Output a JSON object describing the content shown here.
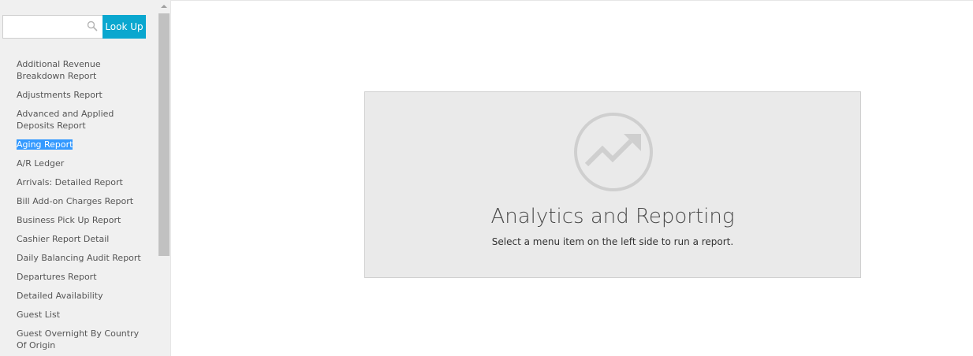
{
  "sidebar": {
    "search": {
      "value": "",
      "placeholder": "",
      "lookup_label": "Look Up"
    },
    "reports": [
      {
        "label": "Additional Revenue Breakdown Report",
        "selected": false
      },
      {
        "label": "Adjustments Report",
        "selected": false
      },
      {
        "label": "Advanced and Applied Deposits Report",
        "selected": false
      },
      {
        "label": "Aging Report",
        "selected": true
      },
      {
        "label": "A/R Ledger",
        "selected": false
      },
      {
        "label": "Arrivals: Detailed Report",
        "selected": false
      },
      {
        "label": "Bill Add-on Charges Report",
        "selected": false
      },
      {
        "label": "Business Pick Up Report",
        "selected": false
      },
      {
        "label": "Cashier Report Detail",
        "selected": false
      },
      {
        "label": "Daily Balancing Audit Report",
        "selected": false
      },
      {
        "label": "Departures Report",
        "selected": false
      },
      {
        "label": "Detailed Availability",
        "selected": false
      },
      {
        "label": "Guest List",
        "selected": false
      },
      {
        "label": "Guest Overnight By Country Of Origin",
        "selected": false
      }
    ]
  },
  "main": {
    "icon": "trending-up-icon",
    "title": "Analytics and Reporting",
    "subtitle": "Select a menu item on the left side to run a report."
  },
  "colors": {
    "accent": "#0aa7cf",
    "selection": "#3399ff",
    "panel_background": "#eaeaea",
    "sidebar_background": "#f0f0f0"
  }
}
